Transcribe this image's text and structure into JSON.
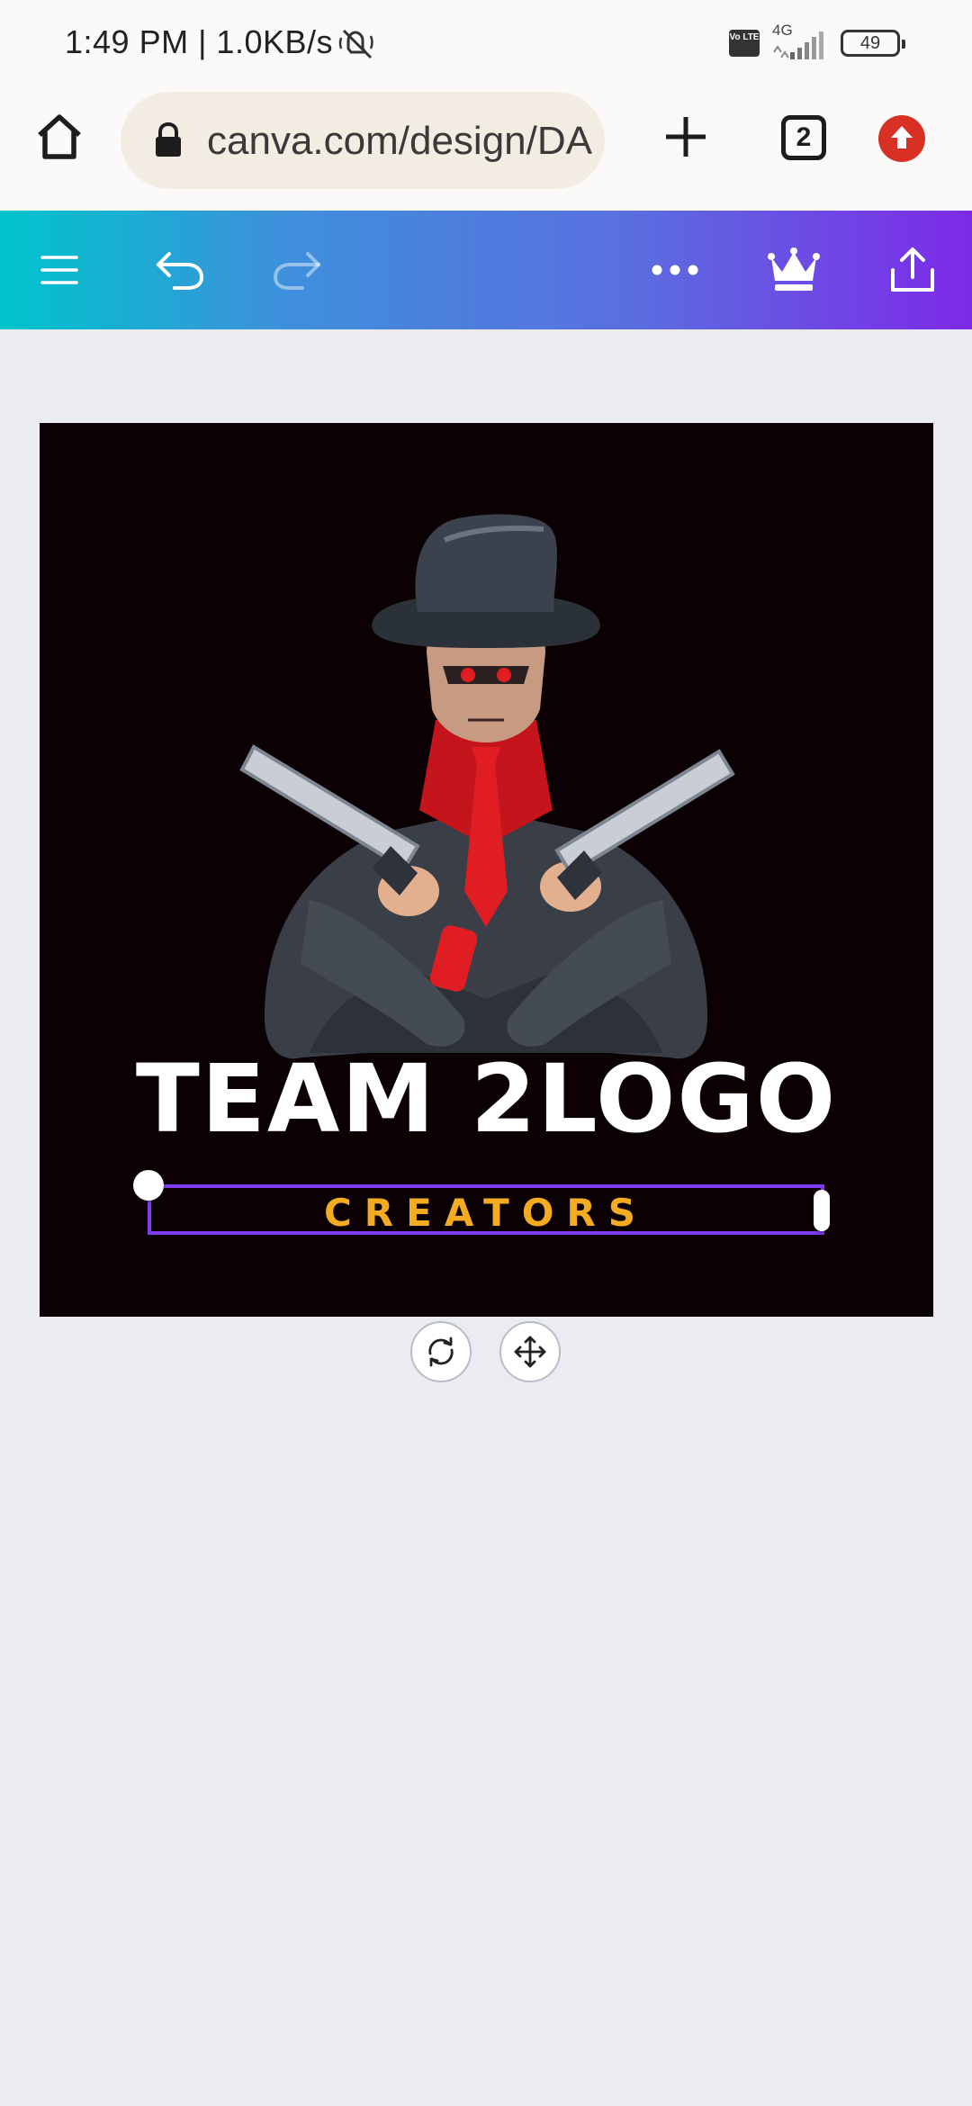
{
  "status_bar": {
    "time": "1:49 PM | 1.0KB/s",
    "network": "4G",
    "volte": "Vo LTE",
    "battery": "49"
  },
  "browser": {
    "url": "canva.com/design/DA",
    "tab_count": "2",
    "icons": [
      "home-icon",
      "lock-icon",
      "plus-icon",
      "tabs-icon",
      "update-icon"
    ]
  },
  "toolbar": {
    "icons": [
      "menu-icon",
      "undo-icon",
      "redo-icon",
      "more-icon",
      "crown-icon",
      "share-icon"
    ]
  },
  "design": {
    "title": "TEAM 2LOGO",
    "subtitle": "CREATORS"
  },
  "canvas_controls": {
    "icons": [
      "rotate-icon",
      "move-icon"
    ]
  },
  "colors": {
    "gradient_start": "#00c4cc",
    "gradient_end": "#7d2ae8",
    "selection": "#7d3cf0",
    "subtitle": "#f3ac22",
    "canvas_bg": "#0b0004",
    "workspace_bg": "#eaecf1"
  }
}
